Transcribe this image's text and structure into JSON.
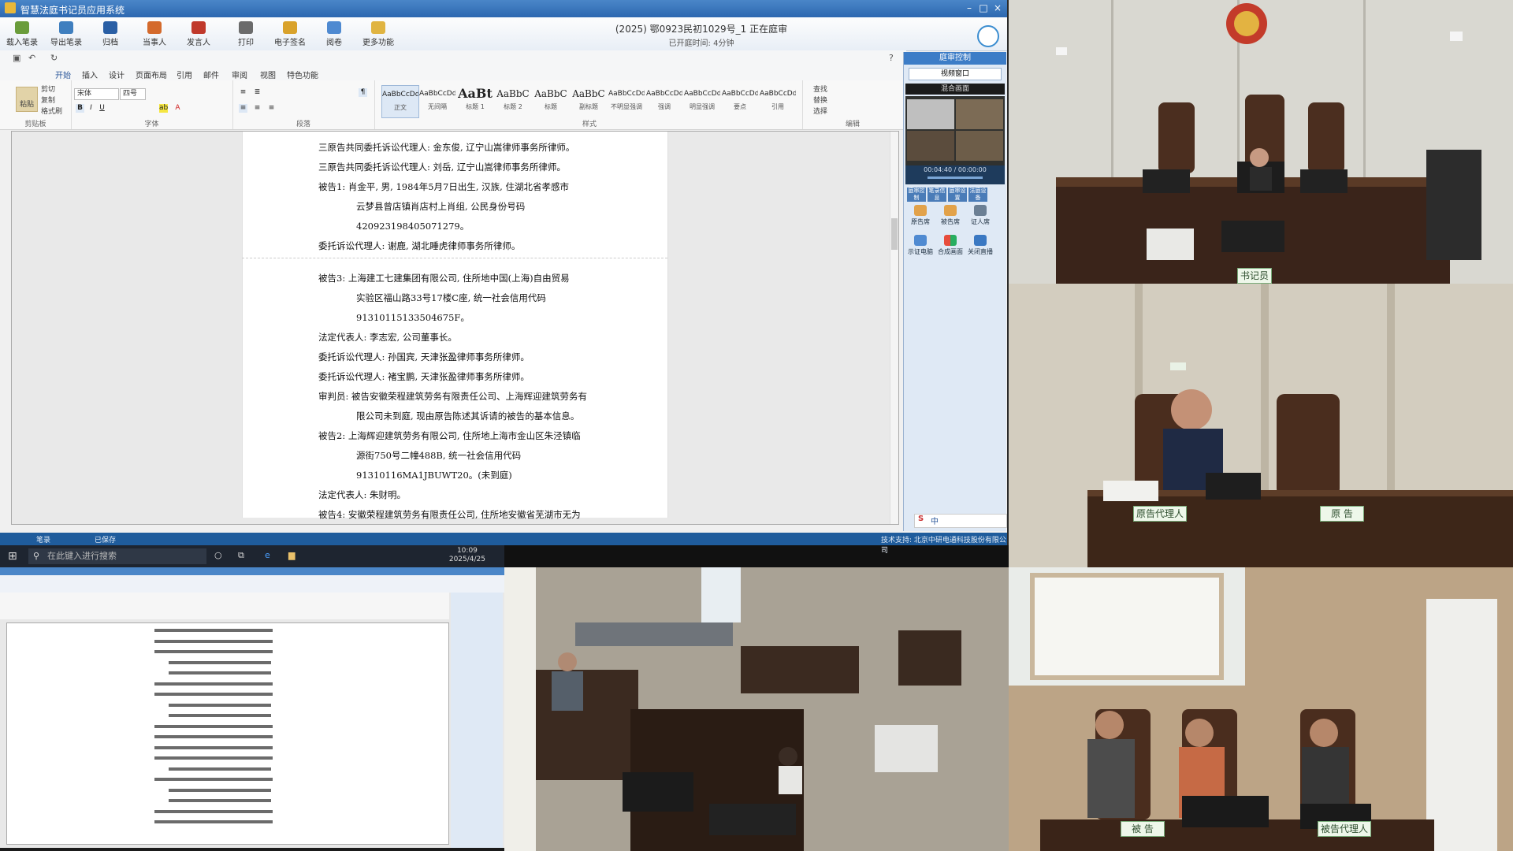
{
  "app": {
    "title": "智慧法庭书记员应用系统",
    "case_number": "(2025) 鄂0923民初1029号_1  正在庭审",
    "elapsed": "已开庭时间: 4分钟",
    "toolbar": [
      "载入笔录",
      "导出笔录",
      "归档",
      "当事人",
      "发言人",
      "打印",
      "电子签名",
      "阅卷",
      "更多功能"
    ],
    "ribbon_tabs": [
      "开始",
      "插入",
      "设计",
      "页面布局",
      "引用",
      "邮件",
      "审阅",
      "视图",
      "特色功能"
    ],
    "ribbon_tab_active": "开始",
    "clipboard": {
      "paste": "粘贴",
      "cut": "剪切",
      "copy": "复制",
      "format_painter": "格式刷",
      "label": "剪贴板"
    },
    "font": {
      "name": "宋体",
      "size": "四号",
      "label": "字体"
    },
    "paragraph_label": "段落",
    "styles_label": "样式",
    "editing_label": "编辑",
    "editing": [
      "查找",
      "替换",
      "选择"
    ],
    "styles": [
      {
        "sample": "AaBbCcDd",
        "name": "正文"
      },
      {
        "sample": "AaBbCcDd",
        "name": "无间隔"
      },
      {
        "sample": "AaBt",
        "name": "标题 1"
      },
      {
        "sample": "AaBbC",
        "name": "标题 2"
      },
      {
        "sample": "AaBbC",
        "name": "标题"
      },
      {
        "sample": "AaBbC",
        "name": "副标题"
      },
      {
        "sample": "AaBbCcDd",
        "name": "不明显强调"
      },
      {
        "sample": "AaBbCcDd",
        "name": "强调"
      },
      {
        "sample": "AaBbCcDd",
        "name": "明显强调"
      },
      {
        "sample": "AaBbCcDd",
        "name": "要点"
      },
      {
        "sample": "AaBbCcDd",
        "name": "引用"
      }
    ],
    "status_left": "笔录",
    "status_mid": "已保存",
    "status_right": "技术支持: 北京中研电通科技股份有限公司",
    "panel": {
      "header": "庭审控制",
      "view_select": "视频窗口",
      "layout_select": "混合画面",
      "player_time": "00:04:40 / 00:00:00",
      "tabs": [
        "庭审控制",
        "笔录信息",
        "庭审设置",
        "法庭设备"
      ],
      "buttons": [
        "原告席",
        "被告席",
        "证人席",
        "示证电脑",
        "合成画面",
        "关闭直播"
      ]
    }
  },
  "document": {
    "lines": [
      {
        "text": "三原告共同委托诉讼代理人: 金东俊, 辽宁山嵩律师事务所律师。",
        "indent": false
      },
      {
        "text": "三原告共同委托诉讼代理人: 刘岳, 辽宁山嵩律师事务所律师。",
        "indent": false
      },
      {
        "text": "被告1: 肖金平, 男, 1984年5月7日出生, 汉族, 住湖北省孝感市",
        "indent": false
      },
      {
        "text": "云梦县曾店镇肖店村上肖组, 公民身份号码",
        "indent": true
      },
      {
        "text": "420923198405071279。",
        "indent": true
      },
      {
        "text": "委托诉讼代理人: 谢鹿, 湖北睡虎律师事务所律师。",
        "indent": false
      },
      {
        "text": "被告3: 上海建工七建集团有限公司, 住所地中国(上海)自由贸易",
        "indent": false
      },
      {
        "text": "实验区福山路33号17楼C座, 统一社会信用代码",
        "indent": true
      },
      {
        "text": "91310115133504675F。",
        "indent": true
      },
      {
        "text": "法定代表人: 李志宏, 公司董事长。",
        "indent": false
      },
      {
        "text": "委托诉讼代理人: 孙国宾, 天津张盈律师事务所律师。",
        "indent": false
      },
      {
        "text": "委托诉讼代理人: 褚宝鹏, 天津张盈律师事务所律师。",
        "indent": false
      },
      {
        "text": "审判员: 被告安徽荣程建筑劳务有限责任公司、上海辉迎建筑劳务有",
        "indent": false
      },
      {
        "text": "限公司未到庭, 现由原告陈述其诉请的被告的基本信息。",
        "indent": true
      },
      {
        "text": "被告2: 上海辉迎建筑劳务有限公司, 住所地上海市金山区朱泾镇临",
        "indent": false
      },
      {
        "text": "源街750号二幢488B, 统一社会信用代码",
        "indent": true
      },
      {
        "text": "91310116MA1JBUWT20。(未到庭)",
        "indent": true
      },
      {
        "text": "法定代表人: 朱财明。",
        "indent": false
      },
      {
        "text": "被告4: 安徽荣程建筑劳务有限责任公司, 住所地安徽省芜湖市无为",
        "indent": false
      }
    ]
  },
  "taskbar": {
    "search_placeholder": "在此键入进行搜索",
    "time": "10:09",
    "date": "2025/4/25"
  },
  "video": {
    "judge_tile_sign": "书记员",
    "plaintiff_agent_sign": "原告代理人",
    "plaintiff_sign": "原 告",
    "defendant_sign": "被 告",
    "defendant_agent_sign": "被告代理人"
  },
  "colors": {
    "title_bar": "#2d68b0",
    "status_bar": "#1f5c9c",
    "accent": "#3b8dd0"
  }
}
